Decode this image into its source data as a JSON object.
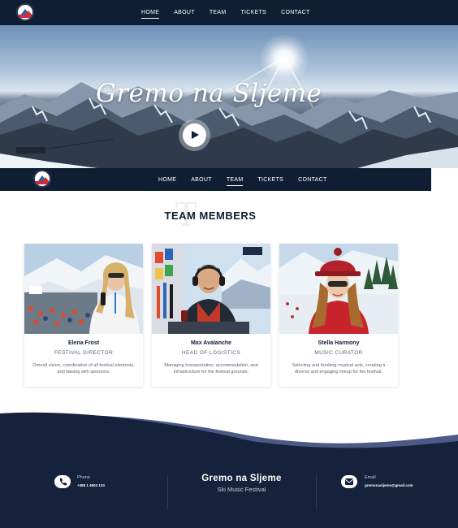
{
  "nav": {
    "items": [
      {
        "label": "HOME",
        "active": true
      },
      {
        "label": "ABOUT",
        "active": false
      },
      {
        "label": "TEAM",
        "active": false
      },
      {
        "label": "TICKETS",
        "active": false
      },
      {
        "label": "CONTACT",
        "active": false
      }
    ]
  },
  "subnav": {
    "items": [
      {
        "label": "HOME",
        "active": false
      },
      {
        "label": "ABOUT",
        "active": false
      },
      {
        "label": "TEAM",
        "active": true
      },
      {
        "label": "TICKETS",
        "active": false
      },
      {
        "label": "CONTACT",
        "active": false
      }
    ]
  },
  "hero": {
    "title": "Gremo na Sljeme",
    "play_icon": "play-icon"
  },
  "team": {
    "watermark": "T",
    "title": "TEAM MEMBERS",
    "members": [
      {
        "name": "Elena Frost",
        "role": "FESTIVAL DIRECTOR",
        "description": "Overall vision, coordination of all festival elements, and liaising with sponsors."
      },
      {
        "name": "Max Avalanche",
        "role": "HEAD OF LOGISTICS",
        "description": "Managing transportation, accommodation, and infrastructure for the festival grounds."
      },
      {
        "name": "Stella Harmony",
        "role": "MUSIC CURATOR",
        "description": "Selecting and booking musical acts, creating a diverse and engaging lineup for the festival."
      }
    ]
  },
  "footer": {
    "phone_label": "Phone",
    "phone_value": "+385 1 4604 124",
    "title": "Gremo na Sljeme",
    "subtitle": "Ski Music Festival",
    "email_label": "Email",
    "email_value": "gremonasljeme@gmail.com",
    "phone_icon": "phone-icon",
    "email_icon": "envelope-icon"
  },
  "colors": {
    "navy": "#0f1e33",
    "footer": "#16213b",
    "wave_accent": "#4b5a86"
  }
}
